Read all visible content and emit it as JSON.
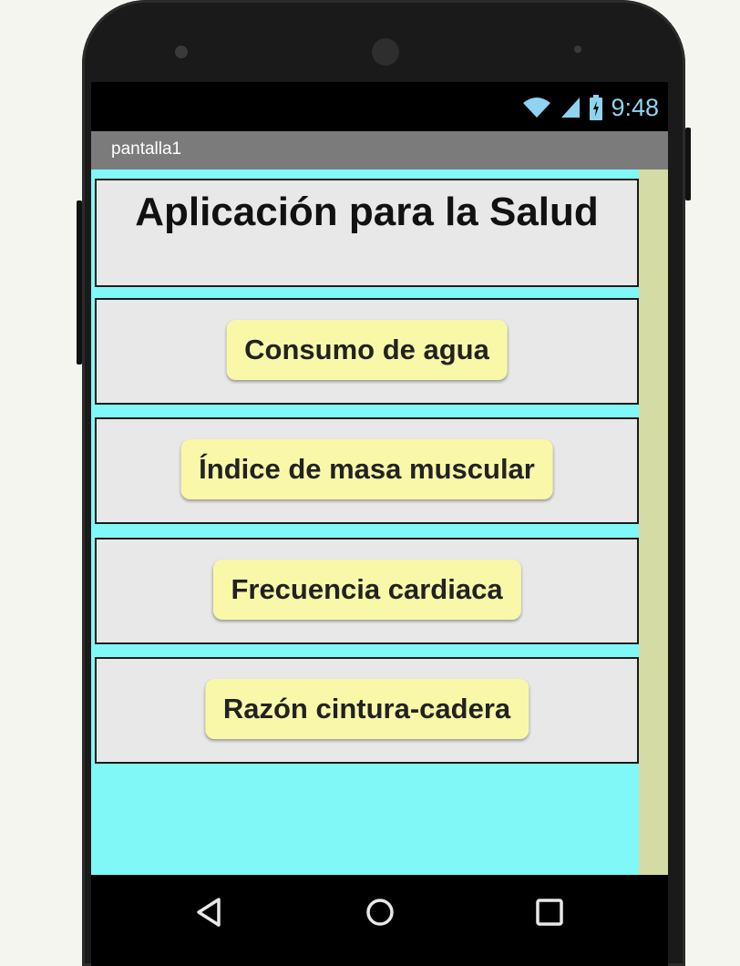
{
  "status_bar": {
    "time": "9:48",
    "icons": [
      "wifi-icon",
      "signal-icon",
      "battery-icon"
    ]
  },
  "app_bar": {
    "title": "pantalla1"
  },
  "main": {
    "heading": "Aplicación para la Salud",
    "buttons": [
      {
        "label": "Consumo de agua"
      },
      {
        "label": "Índice de masa muscular"
      },
      {
        "label": "Frecuencia cardiaca"
      },
      {
        "label": "Razón cintura-cadera"
      }
    ]
  },
  "nav_bar": {
    "icons": [
      "back-icon",
      "home-icon",
      "recents-icon"
    ]
  },
  "colors": {
    "background": "#80f8f8",
    "panel": "#e8e8e8",
    "button": "#f8f8a8",
    "title_bar": "#7b7b7b",
    "scrollbar": "#d4dba4",
    "status_text": "#8fd3f0"
  }
}
